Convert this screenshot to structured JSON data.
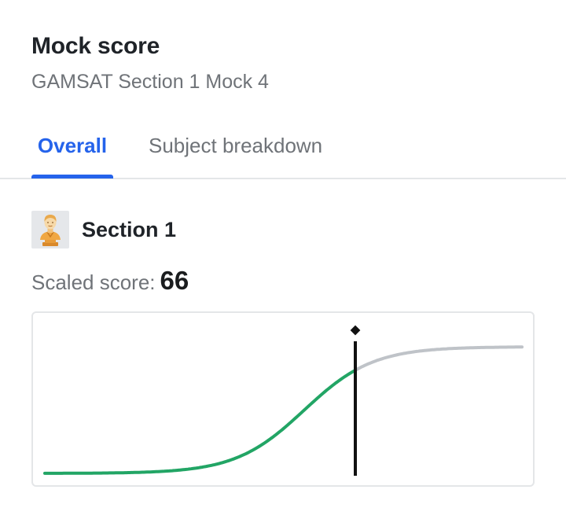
{
  "header": {
    "title": "Mock score",
    "subtitle": "GAMSAT Section 1 Mock 4"
  },
  "tabs": [
    {
      "label": "Overall",
      "active": true
    },
    {
      "label": "Subject breakdown",
      "active": false
    }
  ],
  "section": {
    "icon": "bust-statue-icon",
    "label": "Section 1",
    "score_label": "Scaled score:",
    "score_value": "66"
  },
  "colors": {
    "accent": "#2563eb",
    "achieved_curve": "#22a565",
    "remaining_curve": "#bfc3c8",
    "marker": "#111111"
  },
  "chart_data": {
    "type": "line",
    "description_curve": "sigmoid",
    "marker_value": 66,
    "title": "",
    "xlabel": "",
    "ylabel": ""
  }
}
